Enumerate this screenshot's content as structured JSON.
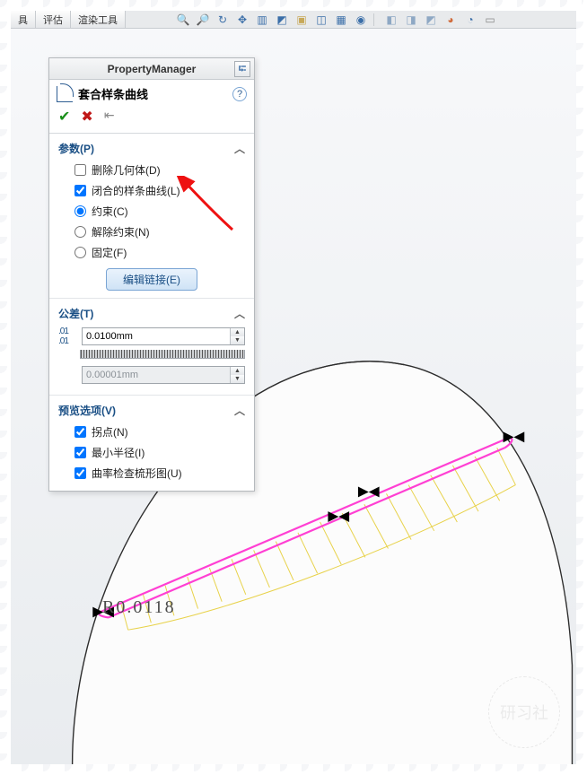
{
  "tabs": {
    "t1": "具",
    "t2": "评估",
    "t3": "渲染工具"
  },
  "pm": {
    "title": "PropertyManager",
    "feature_title": "套合样条曲线",
    "sections": {
      "params": {
        "label": "参数(P)",
        "delete_geom": "删除几何体(D)",
        "closed_spline": "闭合的样条曲线(L)",
        "constrain": "约束(C)",
        "unconstrain": "解除约束(N)",
        "fixed": "固定(F)",
        "edit_chain": "编辑链接(E)"
      },
      "tolerance": {
        "label": "公差(T)",
        "value": "0.0100mm",
        "step": "0.00001mm"
      },
      "preview": {
        "label": "预览选项(V)",
        "inflection": "拐点(N)",
        "min_radius": "最小半径(I)",
        "curvature_comb": "曲率检查梳形图(U)"
      }
    }
  },
  "canvas": {
    "dim_label": "R0.0118",
    "watermark": "研习社"
  }
}
